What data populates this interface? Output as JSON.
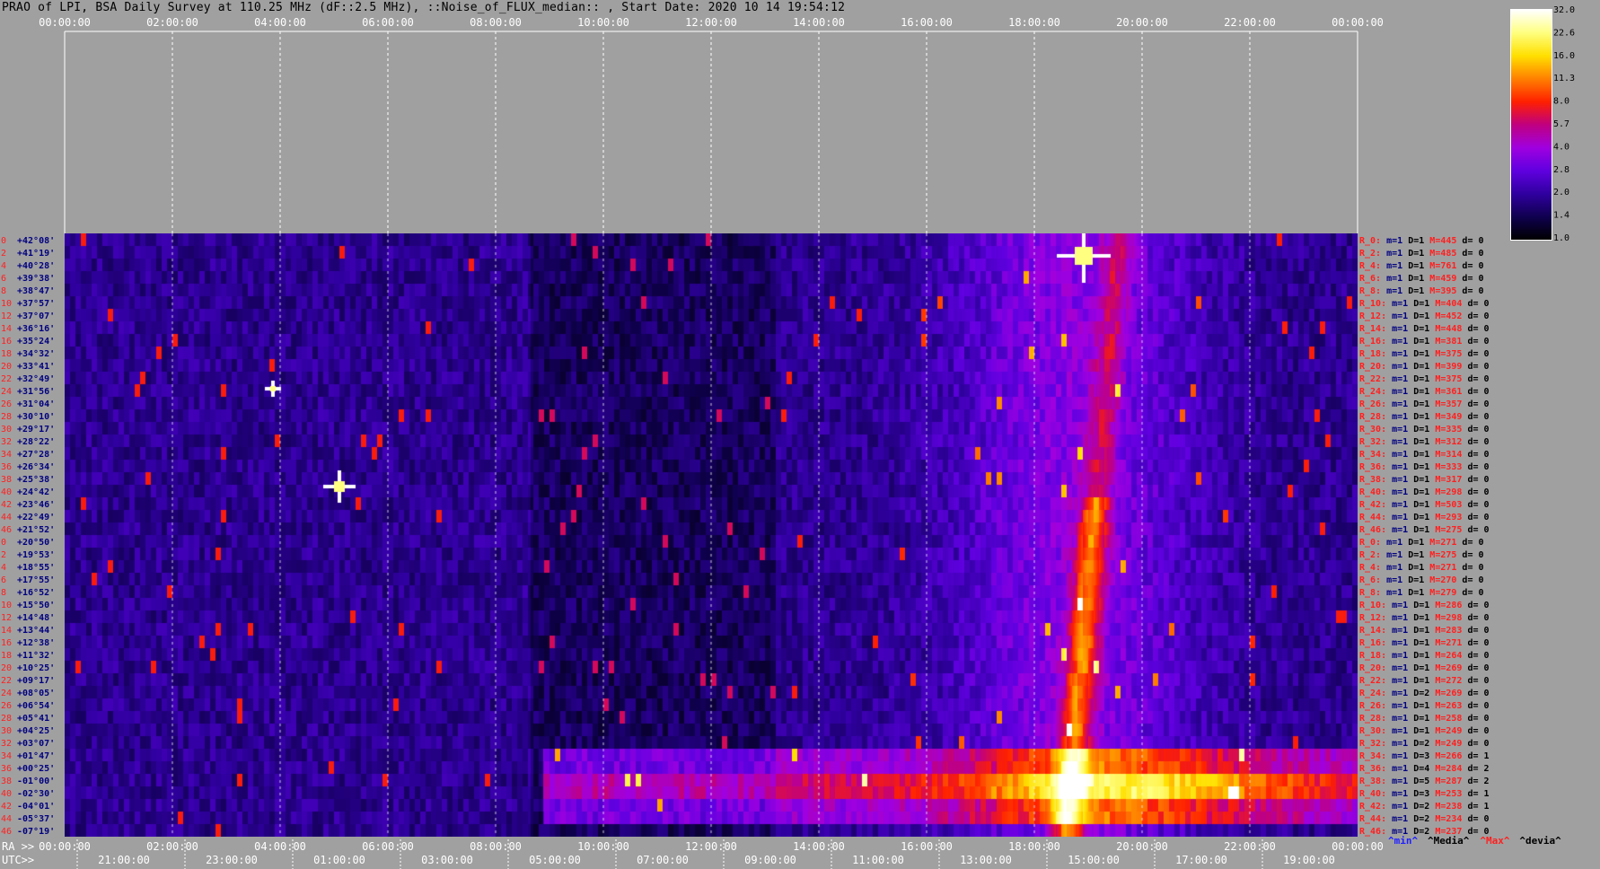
{
  "title": "PRAO of LPI, BSA Daily Survey at 110.25 MHz (dF::2.5 MHz), ::Noise_of_FLUX_median:: , Start Date: 2020 10 14 19:54:12",
  "top_time_labels": [
    "00:00:00",
    "02:00:00",
    "04:00:00",
    "06:00:00",
    "08:00:00",
    "10:00:00",
    "12:00:00",
    "14:00:00",
    "16:00:00",
    "18:00:00",
    "20:00:00",
    "22:00:00",
    "00:00:00"
  ],
  "bottom_prefix_ra": "RA >>",
  "bottom_ra_labels": [
    "00:00:00",
    "02:00:00",
    "04:00:00",
    "06:00:00",
    "08:00:00",
    "10:00:00",
    "12:00:00",
    "14:00:00",
    "16:00:00",
    "18:00:00",
    "20:00:00",
    "22:00:00",
    "00:00:00"
  ],
  "bottom_prefix_utc": "UTC>>",
  "bottom_utc_labels": [
    "21:00:00",
    "23:00:00",
    "01:00:00",
    "03:00:00",
    "05:00:00",
    "07:00:00",
    "09:00:00",
    "11:00:00",
    "13:00:00",
    "15:00:00",
    "17:00:00",
    "19:00:00"
  ],
  "colorbar": {
    "ticks": [
      "32.0",
      "22.6",
      "16.0",
      "11.3",
      "8.0",
      "5.7",
      "4.0",
      "2.8",
      "2.0",
      "1.4",
      "1.0"
    ],
    "gradient": [
      "#ffffff",
      "#ffff80",
      "#ffe000",
      "#ff8000",
      "#ff2000",
      "#c00080",
      "#a000e0",
      "#6000e0",
      "#3000a0",
      "#100050",
      "#000000"
    ]
  },
  "row_index_labels": [
    "0",
    "2",
    "4",
    "6",
    "8",
    "10",
    "12",
    "14",
    "16",
    "18",
    "20",
    "22",
    "24",
    "26",
    "28",
    "30",
    "32",
    "34",
    "36",
    "38",
    "40",
    "42",
    "44",
    "46",
    "0",
    "2",
    "4",
    "6",
    "8",
    "10",
    "12",
    "14",
    "16",
    "18",
    "20",
    "22",
    "24",
    "26",
    "28",
    "30",
    "32",
    "34",
    "36",
    "38",
    "40",
    "42",
    "44",
    "46"
  ],
  "declinations": [
    "+42°08'",
    "+41°19'",
    "+40°28'",
    "+39°38'",
    "+38°47'",
    "+37°57'",
    "+37°07'",
    "+36°16'",
    "+35°24'",
    "+34°32'",
    "+33°41'",
    "+32°49'",
    "+31°56'",
    "+31°04'",
    "+30°10'",
    "+29°17'",
    "+28°22'",
    "+27°28'",
    "+26°34'",
    "+25°38'",
    "+24°42'",
    "+23°46'",
    "+22°49'",
    "+21°52'",
    "+20°50'",
    "+19°53'",
    "+18°55'",
    "+17°55'",
    "+16°52'",
    "+15°50'",
    "+14°48'",
    "+13°44'",
    "+12°38'",
    "+11°32'",
    "+10°25'",
    "+09°17'",
    "+08°05'",
    "+06°54'",
    "+05°41'",
    "+04°25'",
    "+03°07'",
    "+01°47'",
    "+00°25'",
    "-01°00'",
    "-02°30'",
    "-04°01'",
    "-05°37'",
    "-07°19'"
  ],
  "beam_stats": [
    {
      "r": "R_0:",
      "m": "m=1",
      "d": "D=1",
      "M": "M=445",
      "dv": "d= 0"
    },
    {
      "r": "R_2:",
      "m": "m=1",
      "d": "D=1",
      "M": "M=485",
      "dv": "d= 0"
    },
    {
      "r": "R_4:",
      "m": "m=1",
      "d": "D=1",
      "M": "M=761",
      "dv": "d= 0"
    },
    {
      "r": "R_6:",
      "m": "m=1",
      "d": "D=1",
      "M": "M=459",
      "dv": "d= 0"
    },
    {
      "r": "R_8:",
      "m": "m=1",
      "d": "D=1",
      "M": "M=395",
      "dv": "d= 0"
    },
    {
      "r": "R_10:",
      "m": "m=1",
      "d": "D=1",
      "M": "M=404",
      "dv": "d= 0"
    },
    {
      "r": "R_12:",
      "m": "m=1",
      "d": "D=1",
      "M": "M=452",
      "dv": "d= 0"
    },
    {
      "r": "R_14:",
      "m": "m=1",
      "d": "D=1",
      "M": "M=448",
      "dv": "d= 0"
    },
    {
      "r": "R_16:",
      "m": "m=1",
      "d": "D=1",
      "M": "M=381",
      "dv": "d= 0"
    },
    {
      "r": "R_18:",
      "m": "m=1",
      "d": "D=1",
      "M": "M=375",
      "dv": "d= 0"
    },
    {
      "r": "R_20:",
      "m": "m=1",
      "d": "D=1",
      "M": "M=399",
      "dv": "d= 0"
    },
    {
      "r": "R_22:",
      "m": "m=1",
      "d": "D=1",
      "M": "M=375",
      "dv": "d= 0"
    },
    {
      "r": "R_24:",
      "m": "m=1",
      "d": "D=1",
      "M": "M=361",
      "dv": "d= 0"
    },
    {
      "r": "R_26:",
      "m": "m=1",
      "d": "D=1",
      "M": "M=357",
      "dv": "d= 0"
    },
    {
      "r": "R_28:",
      "m": "m=1",
      "d": "D=1",
      "M": "M=349",
      "dv": "d= 0"
    },
    {
      "r": "R_30:",
      "m": "m=1",
      "d": "D=1",
      "M": "M=335",
      "dv": "d= 0"
    },
    {
      "r": "R_32:",
      "m": "m=1",
      "d": "D=1",
      "M": "M=312",
      "dv": "d= 0"
    },
    {
      "r": "R_34:",
      "m": "m=1",
      "d": "D=1",
      "M": "M=314",
      "dv": "d= 0"
    },
    {
      "r": "R_36:",
      "m": "m=1",
      "d": "D=1",
      "M": "M=333",
      "dv": "d= 0"
    },
    {
      "r": "R_38:",
      "m": "m=1",
      "d": "D=1",
      "M": "M=317",
      "dv": "d= 0"
    },
    {
      "r": "R_40:",
      "m": "m=1",
      "d": "D=1",
      "M": "M=298",
      "dv": "d= 0"
    },
    {
      "r": "R_42:",
      "m": "m=1",
      "d": "D=1",
      "M": "M=503",
      "dv": "d= 0"
    },
    {
      "r": "R_44:",
      "m": "m=1",
      "d": "D=1",
      "M": "M=293",
      "dv": "d= 0"
    },
    {
      "r": "R_46:",
      "m": "m=1",
      "d": "D=1",
      "M": "M=275",
      "dv": "d= 0"
    },
    {
      "r": "R_0:",
      "m": "m=1",
      "d": "D=1",
      "M": "M=271",
      "dv": "d= 0"
    },
    {
      "r": "R_2:",
      "m": "m=1",
      "d": "D=1",
      "M": "M=275",
      "dv": "d= 0"
    },
    {
      "r": "R_4:",
      "m": "m=1",
      "d": "D=1",
      "M": "M=271",
      "dv": "d= 0"
    },
    {
      "r": "R_6:",
      "m": "m=1",
      "d": "D=1",
      "M": "M=270",
      "dv": "d= 0"
    },
    {
      "r": "R_8:",
      "m": "m=1",
      "d": "D=1",
      "M": "M=279",
      "dv": "d= 0"
    },
    {
      "r": "R_10:",
      "m": "m=1",
      "d": "D=1",
      "M": "M=286",
      "dv": "d= 0"
    },
    {
      "r": "R_12:",
      "m": "m=1",
      "d": "D=1",
      "M": "M=298",
      "dv": "d= 0"
    },
    {
      "r": "R_14:",
      "m": "m=1",
      "d": "D=1",
      "M": "M=283",
      "dv": "d= 0"
    },
    {
      "r": "R_16:",
      "m": "m=1",
      "d": "D=1",
      "M": "M=271",
      "dv": "d= 0"
    },
    {
      "r": "R_18:",
      "m": "m=1",
      "d": "D=1",
      "M": "M=264",
      "dv": "d= 0"
    },
    {
      "r": "R_20:",
      "m": "m=1",
      "d": "D=1",
      "M": "M=269",
      "dv": "d= 0"
    },
    {
      "r": "R_22:",
      "m": "m=1",
      "d": "D=1",
      "M": "M=272",
      "dv": "d= 0"
    },
    {
      "r": "R_24:",
      "m": "m=1",
      "d": "D=2",
      "M": "M=269",
      "dv": "d= 0"
    },
    {
      "r": "R_26:",
      "m": "m=1",
      "d": "D=1",
      "M": "M=263",
      "dv": "d= 0"
    },
    {
      "r": "R_28:",
      "m": "m=1",
      "d": "D=1",
      "M": "M=258",
      "dv": "d= 0"
    },
    {
      "r": "R_30:",
      "m": "m=1",
      "d": "D=1",
      "M": "M=249",
      "dv": "d= 0"
    },
    {
      "r": "R_32:",
      "m": "m=1",
      "d": "D=2",
      "M": "M=249",
      "dv": "d= 0"
    },
    {
      "r": "R_34:",
      "m": "m=1",
      "d": "D=3",
      "M": "M=266",
      "dv": "d= 1"
    },
    {
      "r": "R_36:",
      "m": "m=1",
      "d": "D=4",
      "M": "M=284",
      "dv": "d= 2"
    },
    {
      "r": "R_38:",
      "m": "m=1",
      "d": "D=5",
      "M": "M=287",
      "dv": "d= 2"
    },
    {
      "r": "R_40:",
      "m": "m=1",
      "d": "D=3",
      "M": "M=253",
      "dv": "d= 1"
    },
    {
      "r": "R_42:",
      "m": "m=1",
      "d": "D=2",
      "M": "M=238",
      "dv": "d= 1"
    },
    {
      "r": "R_44:",
      "m": "m=1",
      "d": "D=2",
      "M": "M=234",
      "dv": "d= 0"
    },
    {
      "r": "R_46:",
      "m": "m=1",
      "d": "D=2",
      "M": "M=237",
      "dv": "d= 0"
    }
  ],
  "legend_items": [
    {
      "text": "^min^",
      "color": "#2020ff"
    },
    {
      "text": "^Media^",
      "color": "#000000"
    },
    {
      "text": "^Max^",
      "color": "#ff2020"
    },
    {
      "text": "^devia^",
      "color": "#000000"
    }
  ],
  "colors": {
    "background": "#a0a0a0",
    "grid": "#ffffff",
    "row_label": "#ff2020",
    "dec_label": "#000080"
  },
  "chart_data": {
    "type": "heatmap",
    "title": "PRAO of LPI, BSA Daily Survey at 110.25 MHz (dF::2.5 MHz), ::Noise_of_FLUX_median:: , Start Date: 2020 10 14 19:54:12",
    "x_axis": "Sidereal time (RA) 00:00:00 – 24:00:00, UTC 19:54 start",
    "y_axis": "48 beams, declination +42°08' to -07°19'",
    "colorbar_range": [
      1.0,
      32.0
    ],
    "colorbar_scale": "log",
    "features": [
      {
        "name": "Galactic plane",
        "ra_range": [
          "18:00",
          "21:00"
        ],
        "note": "diagonal band crossing declinations"
      },
      {
        "name": "bright source",
        "ra": "20:00",
        "dec": "+40°28'"
      },
      {
        "name": "bright source",
        "ra": "05:30",
        "dec": "+22°49'"
      },
      {
        "name": "bright band",
        "dec_range": [
          "+01°47'",
          "-02°30'"
        ],
        "ra_range": [
          "09:00",
          "24:00"
        ]
      }
    ]
  }
}
